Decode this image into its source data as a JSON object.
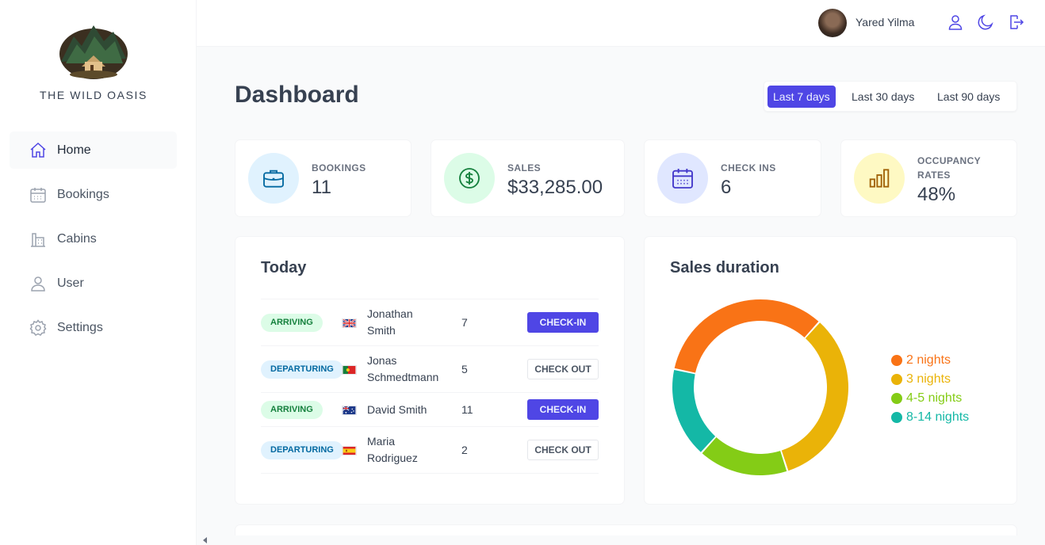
{
  "app": {
    "brand": "THE WILD OASIS"
  },
  "sidebar": {
    "items": [
      {
        "label": "Home",
        "icon": "home-icon",
        "active": true
      },
      {
        "label": "Bookings",
        "icon": "calendar-icon",
        "active": false
      },
      {
        "label": "Cabins",
        "icon": "cabins-icon",
        "active": false
      },
      {
        "label": "User",
        "icon": "user-icon",
        "active": false
      },
      {
        "label": "Settings",
        "icon": "gear-icon",
        "active": false
      }
    ]
  },
  "header": {
    "username": "Yared Yilma",
    "icons": [
      "user-icon",
      "moon-icon",
      "logout-icon"
    ]
  },
  "main": {
    "title": "Dashboard",
    "filters": [
      {
        "label": "Last 7 days",
        "active": true
      },
      {
        "label": "Last 30 days",
        "active": false
      },
      {
        "label": "Last 90 days",
        "active": false
      }
    ],
    "stats": [
      {
        "title": "BOOKINGS",
        "value": "11",
        "icon": "briefcase-icon",
        "color": "#e0f2fe"
      },
      {
        "title": "SALES",
        "value": "$33,285.00",
        "icon": "dollar-icon",
        "color": "#dcfce7"
      },
      {
        "title": "CHECK INS",
        "value": "6",
        "icon": "calendar-days-icon",
        "color": "#e0e7ff"
      },
      {
        "title": "OCCUPANCY RATES",
        "title_line1": "OCCUPANCY",
        "title_line2": "RATES",
        "value": "48%",
        "icon": "chart-bar-icon",
        "color": "#fef9c3"
      }
    ],
    "today": {
      "title": "Today",
      "rows": [
        {
          "status": "ARRIVING",
          "flag": "uk",
          "guest_line1": "Jonathan",
          "guest_line2": "Smith",
          "nights": "7",
          "action": "CHECK-IN"
        },
        {
          "status": "DEPARTURING",
          "flag": "portugal",
          "guest_line1": "Jonas",
          "guest_line2": "Schmedtmann",
          "nights": "5",
          "action": "CHECK OUT"
        },
        {
          "status": "ARRIVING",
          "flag": "australia",
          "guest_line1": "David Smith",
          "guest_line2": "",
          "nights": "11",
          "action": "CHECK-IN"
        },
        {
          "status": "DEPARTURING",
          "flag": "spain",
          "guest_line1": "Maria",
          "guest_line2": "Rodriguez",
          "nights": "2",
          "action": "CHECK OUT"
        }
      ]
    },
    "sales_duration": {
      "title": "Sales duration"
    }
  },
  "chart_data": {
    "type": "pie",
    "title": "Sales duration",
    "categories": [
      "2 nights",
      "3 nights",
      "4-5 nights",
      "8-14 nights"
    ],
    "values": [
      4,
      4,
      2,
      2
    ],
    "colors": [
      "#f97316",
      "#eab308",
      "#84cc16",
      "#14b8a6"
    ],
    "legend": "right"
  }
}
